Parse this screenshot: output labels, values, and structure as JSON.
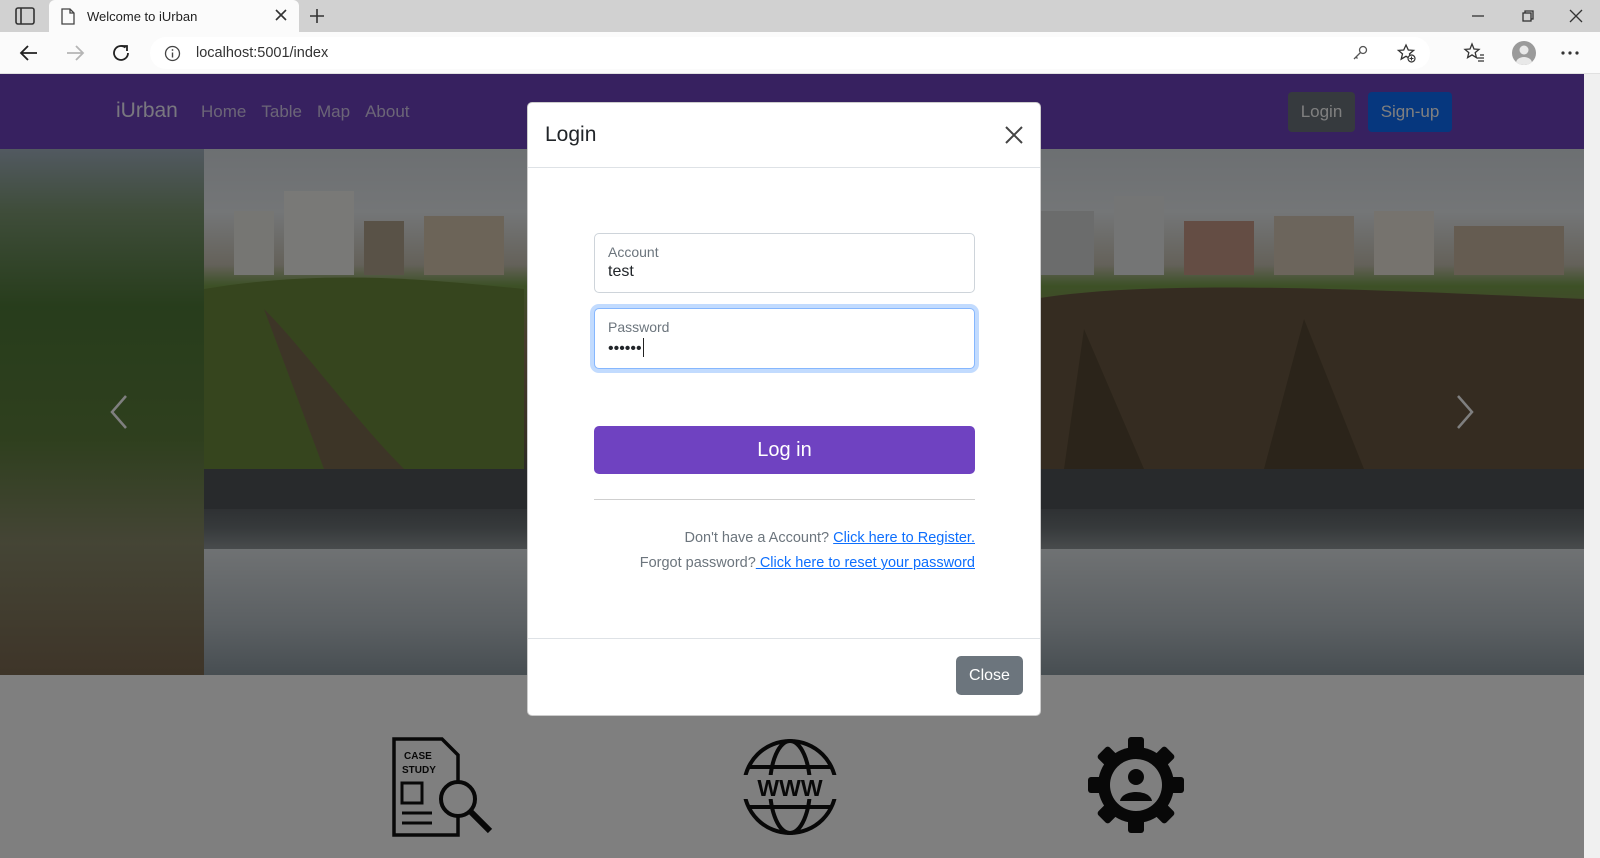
{
  "browser": {
    "tab_title": "Welcome to iUrban",
    "url": "localhost:5001/index"
  },
  "navbar": {
    "brand": "iUrban",
    "links": [
      "Home",
      "Table",
      "Map",
      "About"
    ],
    "login_label": "Login",
    "signup_label": "Sign-up"
  },
  "modal": {
    "title": "Login",
    "account_label": "Account",
    "account_value": "test",
    "password_label": "Password",
    "password_value": "••••••",
    "submit_label": "Log in",
    "register_prompt": "Don't have a Account?",
    "register_link": "Click here to Register.",
    "forgot_prompt": "Forgot password?",
    "forgot_link": " Click here to reset your password",
    "close_label": "Close"
  },
  "features": {
    "case_study_text_1": "CASE",
    "case_study_text_2": "STUDY",
    "www_text": "WWW"
  },
  "colors": {
    "brand": "#6f42c1",
    "primary": "#0d6efd",
    "secondary": "#6c757d"
  }
}
